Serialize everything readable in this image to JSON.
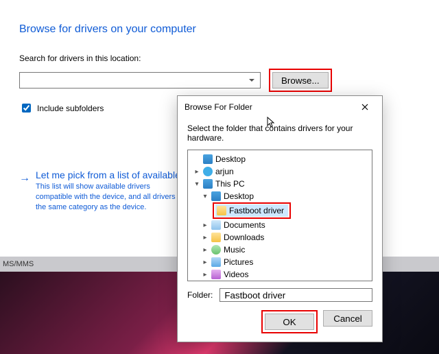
{
  "main": {
    "heading": "Browse for drivers on your computer",
    "search_label": "Search for drivers in this location:",
    "browse_btn": "Browse...",
    "subfolders": "Include subfolders",
    "pick": {
      "title": "Let me pick from a list of available drivers",
      "desc": "This list will show available drivers compatible with the device, and all drivers in the same category as the device."
    },
    "bar_text": "MS/MMS"
  },
  "dlg": {
    "title": "Browse For Folder",
    "msg": "Select the folder that contains drivers for your hardware.",
    "folder_label": "Folder:",
    "folder_value": "Fastboot driver",
    "ok": "OK",
    "cancel": "Cancel",
    "tree": {
      "desktop": "Desktop",
      "user": "arjun",
      "thispc": "This PC",
      "pc_desktop": "Desktop",
      "fastboot": "Fastboot driver",
      "documents": "Documents",
      "downloads": "Downloads",
      "music": "Music",
      "pictures": "Pictures",
      "videos": "Videos"
    }
  }
}
